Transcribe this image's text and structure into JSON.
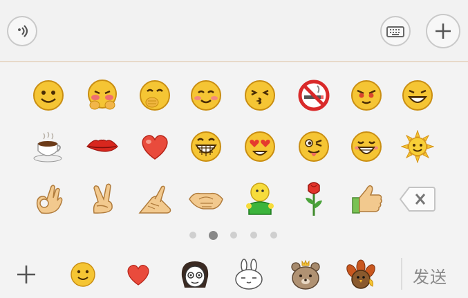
{
  "input": {
    "placeholder": ""
  },
  "pager": {
    "pages": 5,
    "active_index": 1
  },
  "send_label": "发送",
  "colors": {
    "accent_line": "#e7d9c9",
    "emoji_yellow": "#f3c332",
    "heart_red": "#e94b3c"
  },
  "emoji_rows": [
    [
      "smile-icon",
      "blush-hide-icon",
      "giggle-icon",
      "shy-smile-icon",
      "kiss-icon",
      "no-smoking-icon",
      "greedy-eyes-icon",
      "grin-icon"
    ],
    [
      "coffee-icon",
      "lips-icon",
      "heart-icon",
      "big-grin-icon",
      "heart-eyes-icon",
      "wink-tongue-icon",
      "laugh-icon",
      "sun-icon"
    ],
    [
      "ok-hand-icon",
      "victory-hand-icon",
      "fist-salute-icon",
      "handshake-icon",
      "green-figure-icon",
      "rose-icon",
      "thumbs-up-icon",
      "backspace-icon"
    ]
  ],
  "categories": [
    "add-sticker-icon",
    "default-emoji-icon",
    "heart-emoji-icon",
    "girl-sticker-icon",
    "rabbit-sticker-icon",
    "bear-sticker-icon",
    "turkey-sticker-icon"
  ]
}
